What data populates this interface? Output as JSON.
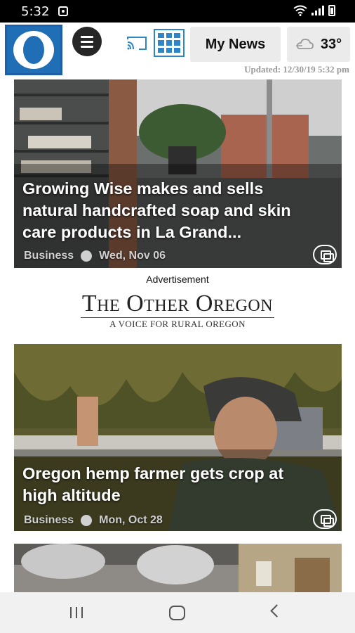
{
  "status_bar": {
    "time": "5:32",
    "icons": [
      "notification-icon",
      "wifi-icon",
      "signal-icon",
      "battery-icon"
    ]
  },
  "header": {
    "logo_icon": "newspaper-o-logo",
    "menu_icon": "hamburger-icon",
    "cast_icon": "cast-icon",
    "grid_icon": "grid-icon",
    "my_news_label": "My News",
    "weather": {
      "icon": "cloudy-icon",
      "temperature": "33°"
    },
    "updated": "Updated: 12/30/19 5:32 pm"
  },
  "articles": [
    {
      "headline": "Growing Wise makes and sells natural handcrafted soap and skin care products in La Grand...",
      "category": "Business",
      "date": "Wed, Nov 06",
      "gallery_icon": "gallery-icon"
    },
    {
      "headline": "Oregon hemp farmer gets crop at high altitude",
      "category": "Business",
      "date": "Mon, Oct 28",
      "gallery_icon": "gallery-icon"
    }
  ],
  "advertisement": {
    "label": "Advertisement",
    "title": "The Other Oregon",
    "subtitle": "A VOICE FOR RURAL OREGON"
  },
  "colors": {
    "brand_blue": "#1f6eb6",
    "grid_blue": "#2f86c7",
    "header_button_bg": "#ebebeb",
    "navbar_bg": "#f1f1f1"
  },
  "navbar": {
    "icons": [
      "recent-apps-icon",
      "home-icon",
      "back-icon"
    ]
  }
}
